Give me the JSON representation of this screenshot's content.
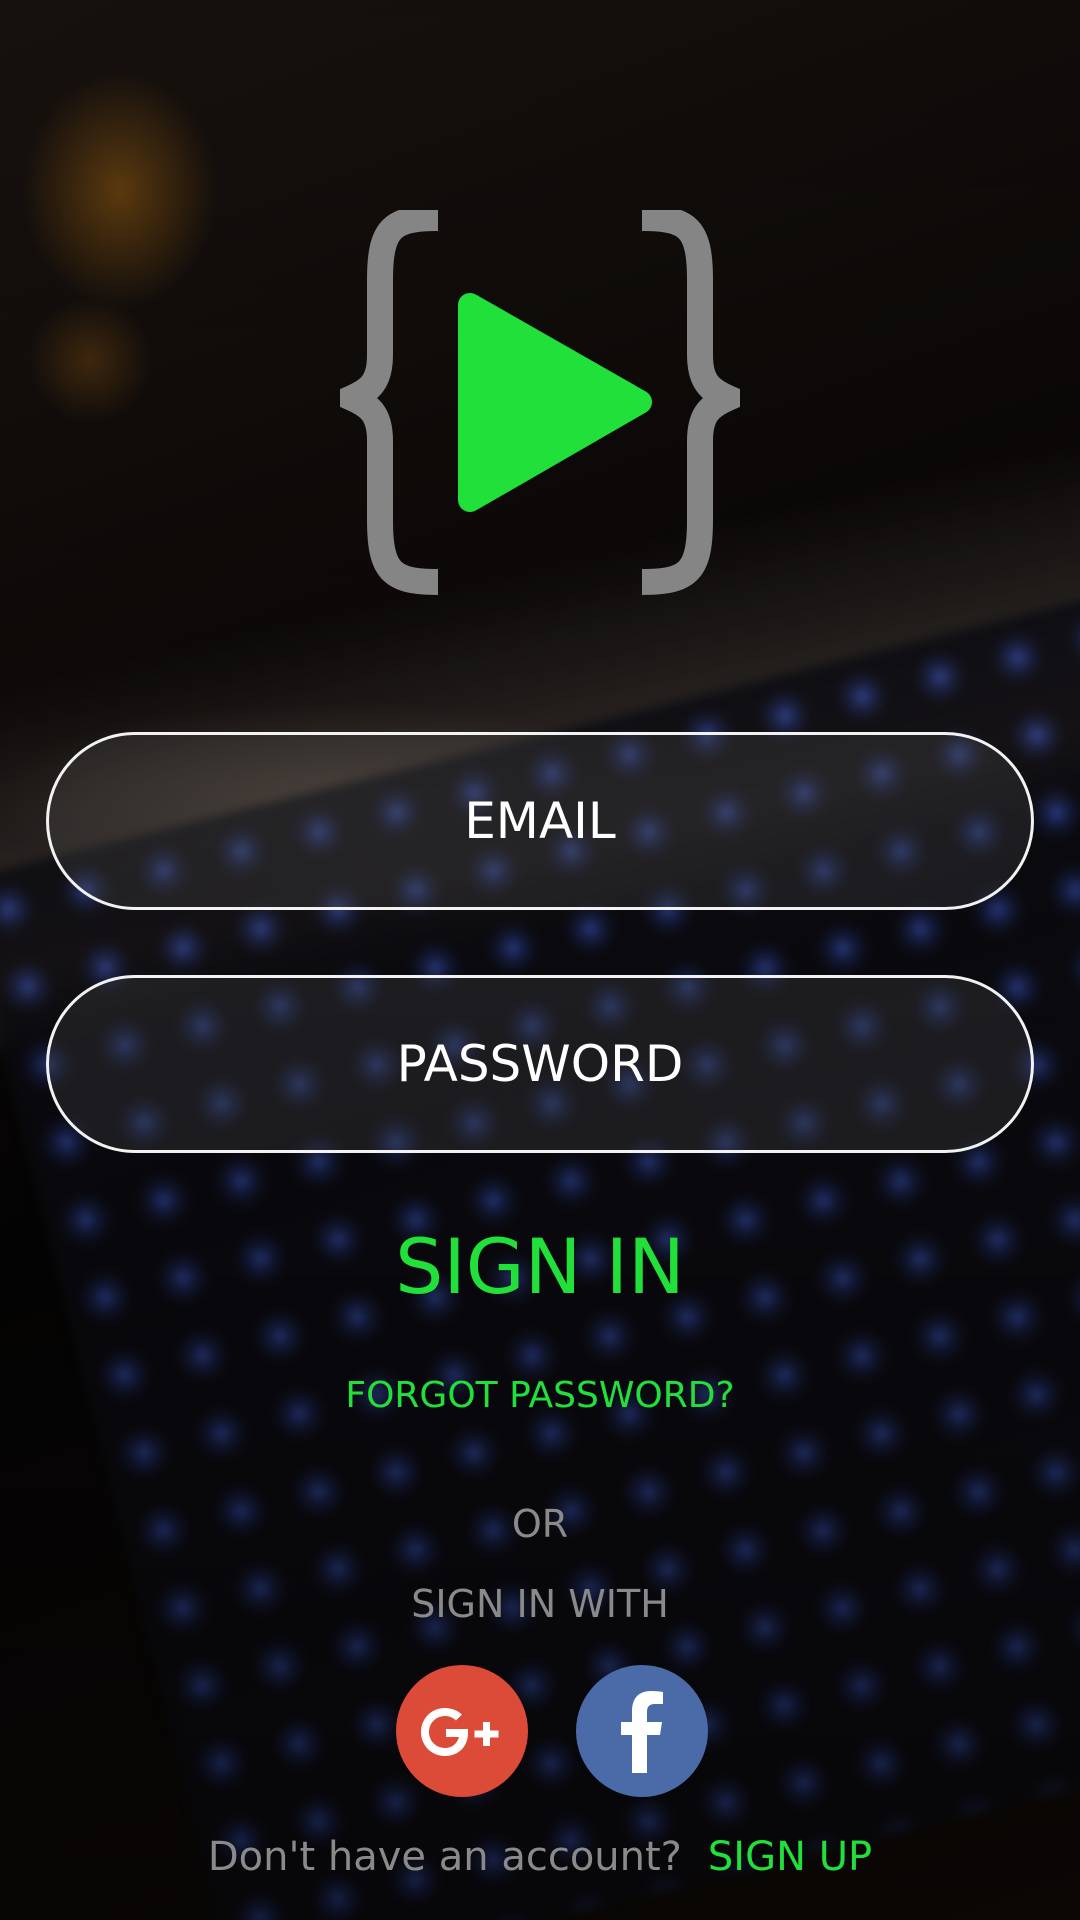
{
  "colors": {
    "accent": "#22e03a",
    "brace": "#858585",
    "muted_text": "#8a8a8a",
    "field_border": "#f2f2f2",
    "google": "#dc4a38",
    "facebook": "#4b6aa8"
  },
  "logo": {
    "icon": "code-play-logo"
  },
  "form": {
    "email_placeholder": "EMAIL",
    "password_placeholder": "PASSWORD",
    "sign_in_label": "SIGN IN",
    "forgot_label": "FORGOT PASSWORD?"
  },
  "divider": {
    "or_label": "OR",
    "sign_in_with_label": "SIGN IN WITH"
  },
  "social": {
    "google_icon": "google-plus-icon",
    "facebook_icon": "facebook-icon"
  },
  "footer": {
    "question": "Don't have an account?",
    "sign_up_label": "SIGN UP"
  }
}
